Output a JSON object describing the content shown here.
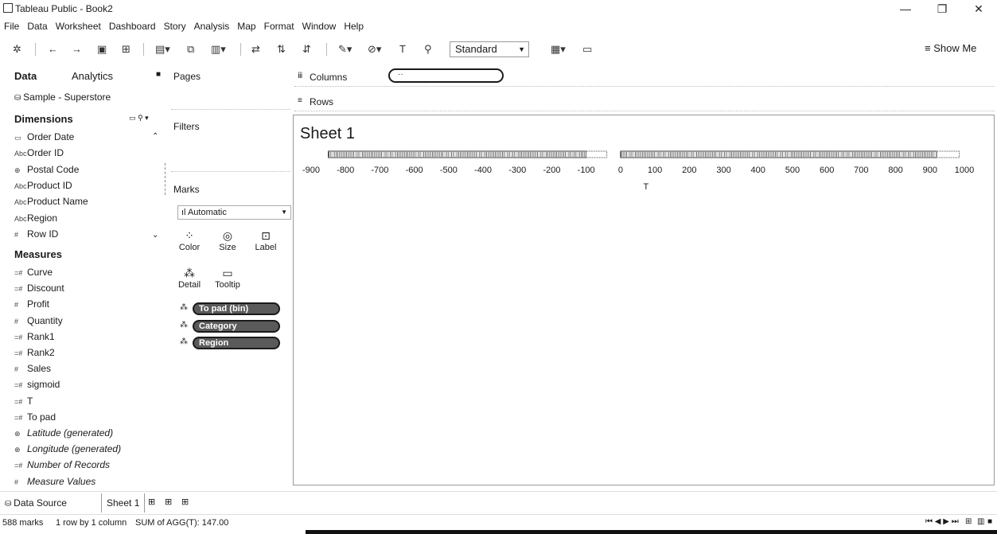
{
  "window": {
    "title": "Tableau Public - Book2",
    "minimize_glyph": "—",
    "restore_glyph": "❐",
    "close_glyph": "✕"
  },
  "menu": [
    "File",
    "Data",
    "Worksheet",
    "Dashboard",
    "Story",
    "Analysis",
    "Map",
    "Format",
    "Window",
    "Help"
  ],
  "toolbar": {
    "fit_value": "Standard",
    "show_me_label": "Show Me"
  },
  "data_pane": {
    "tab_data": "Data",
    "tab_analytics": "Analytics",
    "datasource": "Sample - Superstore",
    "dimensions_header": "Dimensions",
    "measures_header": "Measures",
    "dimensions": [
      {
        "name": "Order Date",
        "icon": "calendar-icon",
        "glyph": "▭"
      },
      {
        "name": "Order ID",
        "icon": "abc-icon",
        "glyph": "Abc"
      },
      {
        "name": "Postal Code",
        "icon": "geo-icon",
        "glyph": "⊕"
      },
      {
        "name": "Product ID",
        "icon": "abc-icon",
        "glyph": "Abc"
      },
      {
        "name": "Product Name",
        "icon": "abc-icon",
        "glyph": "Abc"
      },
      {
        "name": "Region",
        "icon": "abc-icon",
        "glyph": "Abc"
      },
      {
        "name": "Row ID",
        "icon": "number-icon",
        "glyph": "#"
      }
    ],
    "measures": [
      {
        "name": "Curve",
        "icon": "calc-number-icon",
        "glyph": "=#",
        "italic": false
      },
      {
        "name": "Discount",
        "icon": "calc-number-icon",
        "glyph": "=#",
        "italic": false
      },
      {
        "name": "Profit",
        "icon": "number-icon",
        "glyph": "#",
        "italic": false
      },
      {
        "name": "Quantity",
        "icon": "number-icon",
        "glyph": "#",
        "italic": false
      },
      {
        "name": "Rank1",
        "icon": "calc-number-icon",
        "glyph": "=#",
        "italic": false
      },
      {
        "name": "Rank2",
        "icon": "calc-number-icon",
        "glyph": "=#",
        "italic": false
      },
      {
        "name": "Sales",
        "icon": "number-icon",
        "glyph": "#",
        "italic": false
      },
      {
        "name": "sigmoid",
        "icon": "calc-number-icon",
        "glyph": "=#",
        "italic": false
      },
      {
        "name": "T",
        "icon": "calc-number-icon",
        "glyph": "=#",
        "italic": false
      },
      {
        "name": "To pad",
        "icon": "calc-number-icon",
        "glyph": "=#",
        "italic": false
      },
      {
        "name": "Latitude (generated)",
        "icon": "globe-icon",
        "glyph": "⊕",
        "italic": true
      },
      {
        "name": "Longitude (generated)",
        "icon": "globe-icon",
        "glyph": "⊕",
        "italic": true
      },
      {
        "name": "Number of Records",
        "icon": "calc-number-icon",
        "glyph": "=#",
        "italic": true
      },
      {
        "name": "Measure Values",
        "icon": "number-icon",
        "glyph": "#",
        "italic": true
      }
    ]
  },
  "cards": {
    "pages": "Pages",
    "filters": "Filters",
    "marks": "Marks",
    "mark_type": "Automatic",
    "buttons": {
      "color": "Color",
      "size": "Size",
      "label": "Label",
      "detail": "Detail",
      "tooltip": "Tooltip"
    },
    "pills": [
      "To pad (bin)",
      "Category",
      "Region"
    ]
  },
  "shelves": {
    "columns_label": "Columns",
    "rows_label": "Rows",
    "columns_pill": "··"
  },
  "view": {
    "sheet_title": "Sheet 1",
    "axis_title": "T"
  },
  "chart_data": {
    "type": "scatter",
    "title": "Sheet 1",
    "xlabel": "T",
    "ylabel": "",
    "tick_labels": [
      "-900",
      "-800",
      "-700",
      "-600",
      "-500",
      "-400",
      "-300",
      "-200",
      "-100",
      "0",
      "100",
      "200",
      "300",
      "400",
      "500",
      "600",
      "700",
      "800",
      "900",
      "1000"
    ],
    "segments": [
      {
        "from": -850,
        "to": -100,
        "style": "dense-ticks"
      },
      {
        "from": -100,
        "to": -40,
        "style": "empty"
      },
      {
        "from": 0,
        "to": 920,
        "style": "dense-ticks"
      },
      {
        "from": 920,
        "to": 985,
        "style": "empty"
      }
    ]
  },
  "tabs": {
    "data_source": "Data Source",
    "sheet": "Sheet 1"
  },
  "status": {
    "marks": "588 marks",
    "rows_cols": "1 row by 1 column",
    "sum": "SUM of AGG(T): 147.00"
  }
}
